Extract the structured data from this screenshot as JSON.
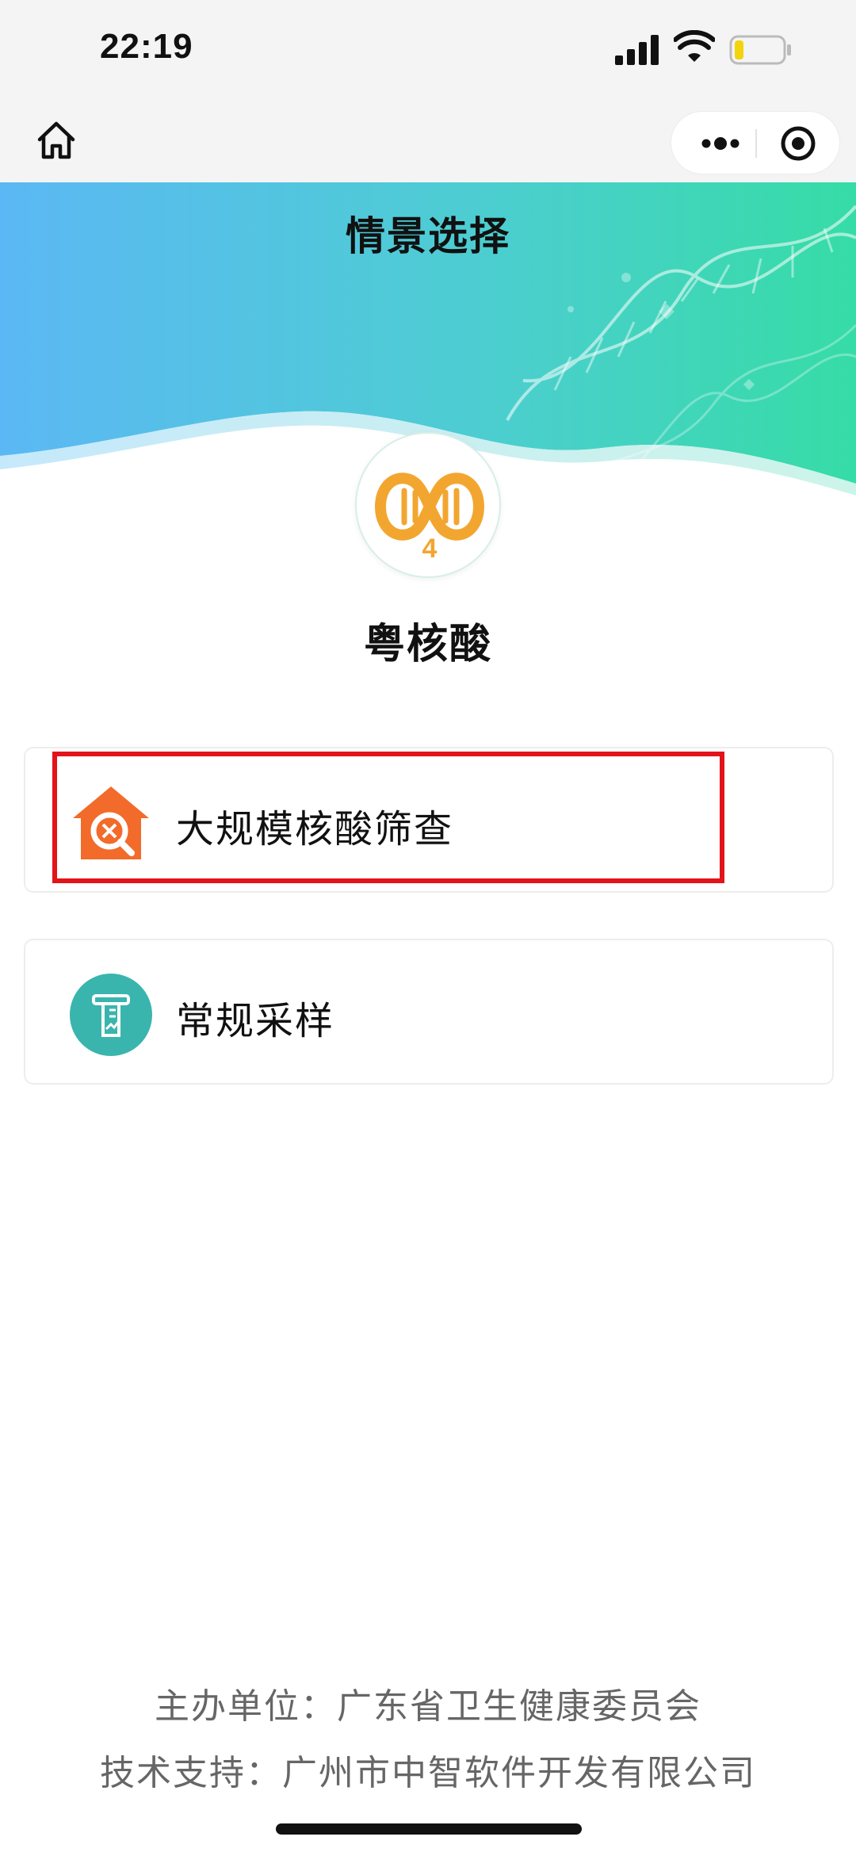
{
  "status_bar": {
    "time": "22:19",
    "icons": [
      "signal-icon",
      "wifi-icon",
      "battery-icon"
    ]
  },
  "nav_bar": {
    "home_icon": "home-icon",
    "menu_icons": [
      "more-icon",
      "target-icon"
    ]
  },
  "header": {
    "title": "情景选择"
  },
  "app": {
    "logo_badge": "4",
    "name": "粤核酸"
  },
  "options": [
    {
      "label": "大规模核酸筛查",
      "icon": "house-search-icon",
      "icon_color": "#f26b2a",
      "highlighted": true
    },
    {
      "label": "常规采样",
      "icon": "sample-tube-icon",
      "icon_color": "#39b5ad",
      "highlighted": false
    }
  ],
  "footer": {
    "organizer": "主办单位：广东省卫生健康委员会",
    "tech_support": "技术支持：广州市中智软件开发有限公司"
  },
  "colors": {
    "banner_start": "#5bb8f4",
    "banner_end": "#36dca6",
    "highlight": "#e2141a",
    "logo_orange": "#f2a630"
  }
}
